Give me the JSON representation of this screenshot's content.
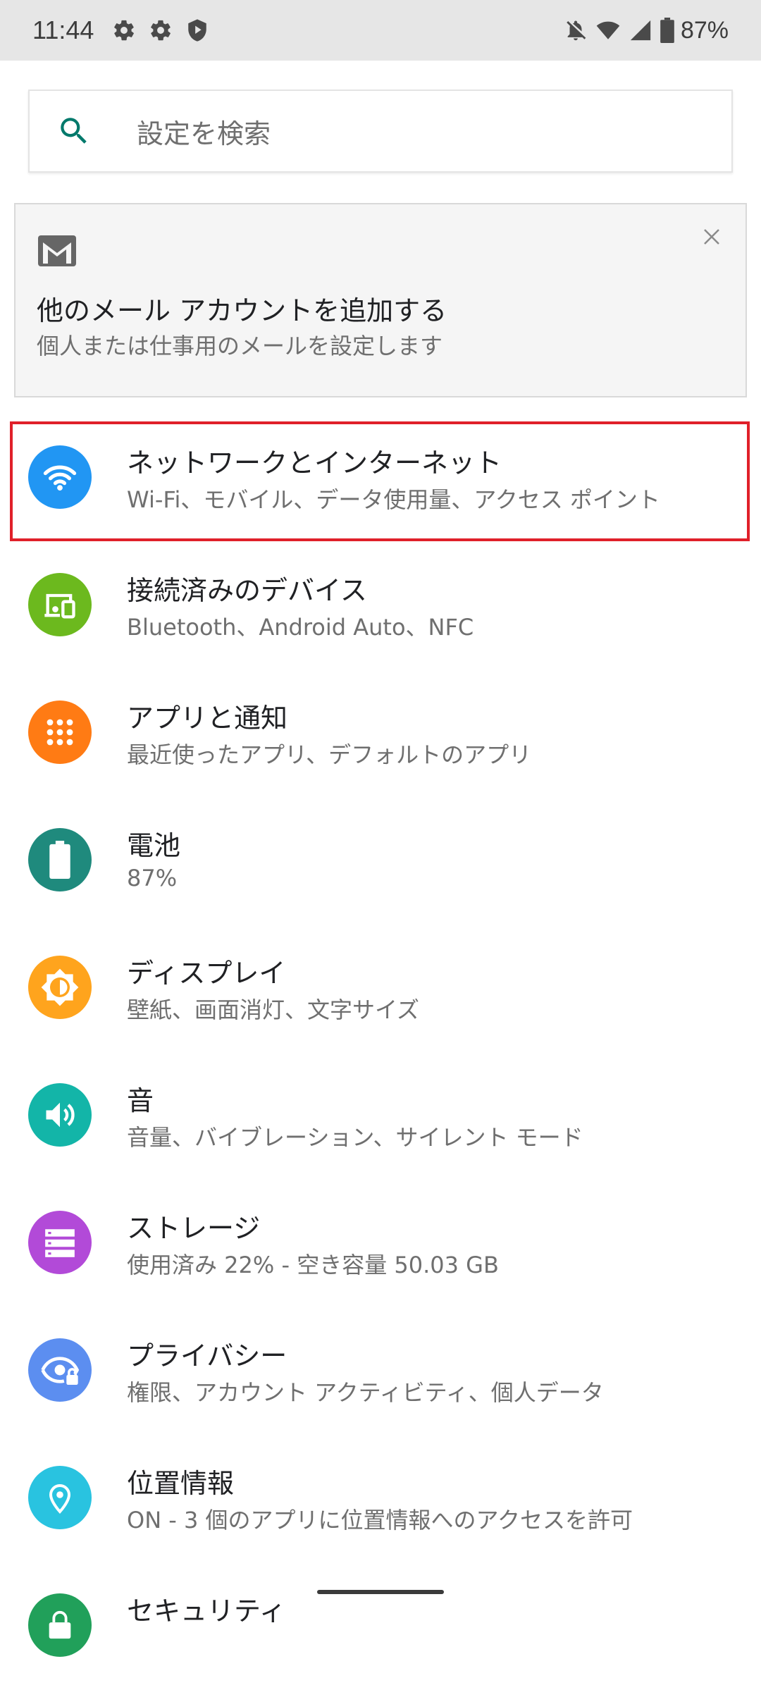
{
  "status_bar": {
    "time": "11:44",
    "battery_percent": "87%",
    "left_icons": [
      "gear-icon",
      "gear-icon",
      "shield-play-icon"
    ],
    "right_icons": [
      "notifications-off-icon",
      "wifi-icon",
      "cell-signal-icon",
      "battery-icon"
    ]
  },
  "search": {
    "placeholder": "設定を検索"
  },
  "suggestion": {
    "icon": "gmail-icon",
    "title": "他のメール アカウントを追加する",
    "summary": "個人または仕事用のメールを設定します"
  },
  "settings": {
    "items": [
      {
        "title": "ネットワークとインターネット",
        "summary": "Wi-Fi、モバイル、データ使用量、アクセス ポイント",
        "icon": "wifi-icon",
        "color": "#2196f3"
      },
      {
        "title": "接続済みのデバイス",
        "summary": "Bluetooth、Android Auto、NFC",
        "icon": "devices-icon",
        "color": "#6cb91e"
      },
      {
        "title": "アプリと通知",
        "summary": "最近使ったアプリ、デフォルトのアプリ",
        "icon": "apps-grid-icon",
        "color": "#ff7b14"
      },
      {
        "title": "電池",
        "summary": "87%",
        "icon": "battery-icon",
        "color": "#1f8a7d"
      },
      {
        "title": "ディスプレイ",
        "summary": "壁紙、画面消灯、文字サイズ",
        "icon": "brightness-icon",
        "color": "#ffa41d"
      },
      {
        "title": "音",
        "summary": "音量、バイブレーション、サイレント モード",
        "icon": "volume-icon",
        "color": "#13b5a8"
      },
      {
        "title": "ストレージ",
        "summary": "使用済み 22% - 空き容量 50.03 GB",
        "icon": "storage-icon",
        "color": "#b24ad8"
      },
      {
        "title": "プライバシー",
        "summary": "権限、アカウント アクティビティ、個人データ",
        "icon": "privacy-eye-icon",
        "color": "#5c8ef0"
      },
      {
        "title": "位置情報",
        "summary": "ON - 3 個のアプリに位置情報へのアクセスを許可",
        "icon": "location-pin-icon",
        "color": "#29c3e0"
      },
      {
        "title": "セキュリティ",
        "summary": "",
        "icon": "lock-icon",
        "color": "#21a05a"
      }
    ]
  },
  "colors": {
    "highlight": "#e0202a",
    "search_icon": "#00796b"
  }
}
